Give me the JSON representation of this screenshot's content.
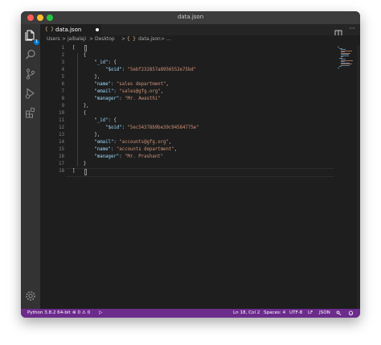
{
  "window": {
    "title": "data.json"
  },
  "tab": {
    "icon_text": "{ }",
    "label": "data.json"
  },
  "breadcrumb": {
    "items": [
      "Users",
      ">",
      "jaibalaji",
      ">",
      "Desktop",
      ">",
      "{ }",
      "data.json",
      ">",
      "..."
    ]
  },
  "activity": {
    "badge": "1"
  },
  "toolbar": {
    "more_label": "···"
  },
  "editor": {
    "lines": [
      {
        "n": "1",
        "text": "["
      },
      {
        "n": "2",
        "text": "    {"
      },
      {
        "n": "3",
        "text": "        \"_id\": {"
      },
      {
        "n": "4",
        "text": "            \"$oid\": \"5ebf232857a8956552e75bd\""
      },
      {
        "n": "5",
        "text": "        },"
      },
      {
        "n": "6",
        "text": "        \"name\": \"sales department\","
      },
      {
        "n": "7",
        "text": "        \"email\": \"sales@gfg.org\","
      },
      {
        "n": "8",
        "text": "        \"manager\": \"Mr. Awasthi\""
      },
      {
        "n": "9",
        "text": "    },"
      },
      {
        "n": "10",
        "text": "    {"
      },
      {
        "n": "11",
        "text": "        \"_id\": {"
      },
      {
        "n": "12",
        "text": "            \"$oid\": \"5ec54378b9be39c94584775e\""
      },
      {
        "n": "13",
        "text": "        },"
      },
      {
        "n": "14",
        "text": "        \"email\": \"accounts@gfg.org\","
      },
      {
        "n": "15",
        "text": "        \"name\": \"accounts department\","
      },
      {
        "n": "16",
        "text": "        \"manager\": \"Mr. Prashant\""
      },
      {
        "n": "17",
        "text": "    }"
      },
      {
        "n": "18",
        "text": "]"
      }
    ]
  },
  "status": {
    "python": "Python 3.8.2 64-bit",
    "errors": "⊗ 0 ⚠ 0",
    "run": "▷",
    "position": "Ln 18, Col 2",
    "spaces": "Spaces: 4",
    "encoding": "UTF-8",
    "eol": "LF",
    "language": "JSON"
  },
  "colors": {
    "status_bar": "#6c2c8c",
    "key": "#9cdcfe",
    "string": "#ce9178",
    "punct": "#d4d4d4"
  }
}
